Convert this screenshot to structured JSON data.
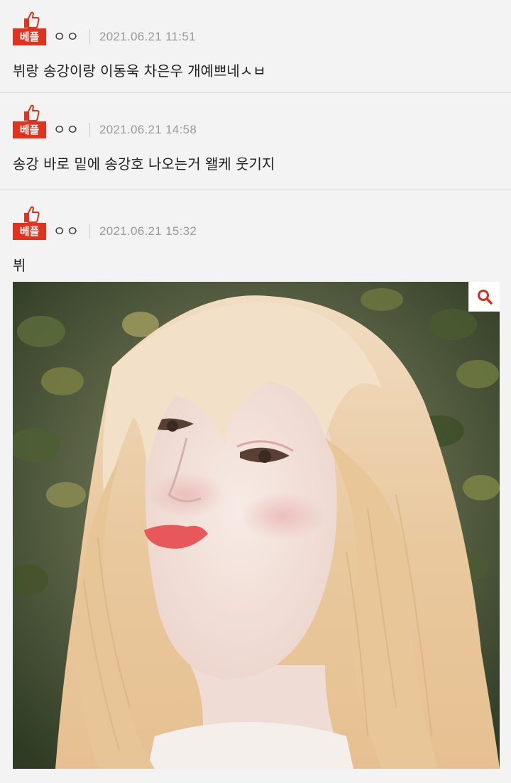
{
  "comments": [
    {
      "badge": "베플",
      "author": "ㅇㅇ",
      "date": "2021.06.21 11:51",
      "text": "뷔랑 송강이랑 이동욱 차은우 개예쁘네ㅅㅂ"
    },
    {
      "badge": "베플",
      "author": "ㅇㅇ",
      "date": "2021.06.21 14:58",
      "text": "송강 바로 밑에 송강호 나오는거 왤케 웃기지"
    },
    {
      "badge": "베플",
      "author": "ㅇㅇ",
      "date": "2021.06.21 15:32",
      "text": "뷔",
      "image_icon": "magnifier-icon"
    }
  ],
  "colors": {
    "badge_red": "#e0321f",
    "background": "#f3f3f3",
    "date_gray": "#9a9a9a"
  }
}
